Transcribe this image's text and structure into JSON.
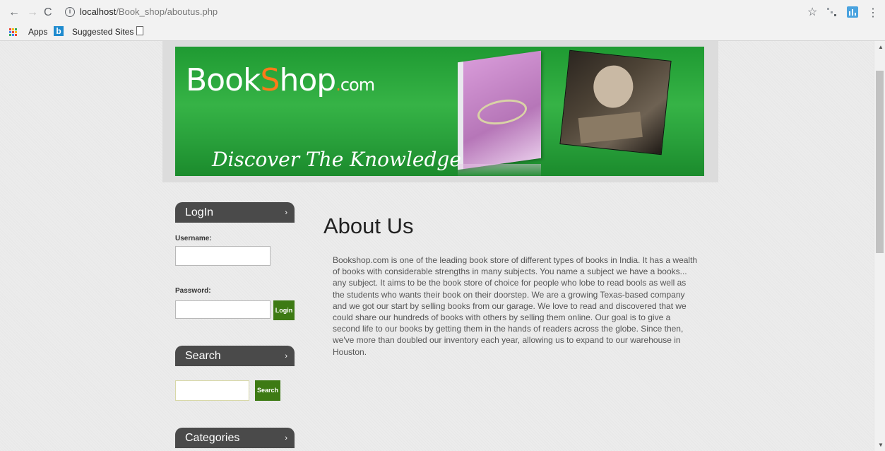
{
  "browser": {
    "url_host": "localhost",
    "url_path": "/Book_shop/aboutus.php",
    "bookmarks": {
      "apps": "Apps",
      "suggested": "Suggested Sites"
    },
    "icons": {
      "back": "←",
      "forward": "→",
      "reload": "C",
      "info": "i",
      "star": "☆",
      "menu": "⋮"
    }
  },
  "banner": {
    "logo_book": "Book",
    "logo_s": "S",
    "logo_hop": "hop",
    "logo_dot": ".",
    "logo_com": "com",
    "tagline": "Discover The Knowledge"
  },
  "sidebar": {
    "login": {
      "title": "LogIn",
      "username_label": "Username:",
      "password_label": "Password:",
      "button": "Login"
    },
    "search": {
      "title": "Search",
      "button": "Search"
    },
    "categories": {
      "title": "Categories"
    },
    "chevron": "›"
  },
  "content": {
    "title": "About Us",
    "body": "Bookshop.com is one of the leading book store of different types of books in India. It has a wealth of books with considerable strengths in many subjects. You name a subject we have a books... any subject. It aims to be the book store of choice for people who lobe to read bools as well as the students who wants their book on their doorstep. We are a growing Texas-based company and we got our start by selling books from our garage. We love to read and discovered that we could share our hundreds of books with others by selling them online. Our goal is to give a second life to our books by getting them in the hands of readers across the globe. Since then, we've more than doubled our inventory each year, allowing us to expand to our warehouse in Houston."
  },
  "colors": {
    "banner_green": "#2aa23c",
    "button_green": "#3d7a14",
    "widget_header": "#4a4a4a",
    "logo_accent": "#ff7a1a"
  }
}
